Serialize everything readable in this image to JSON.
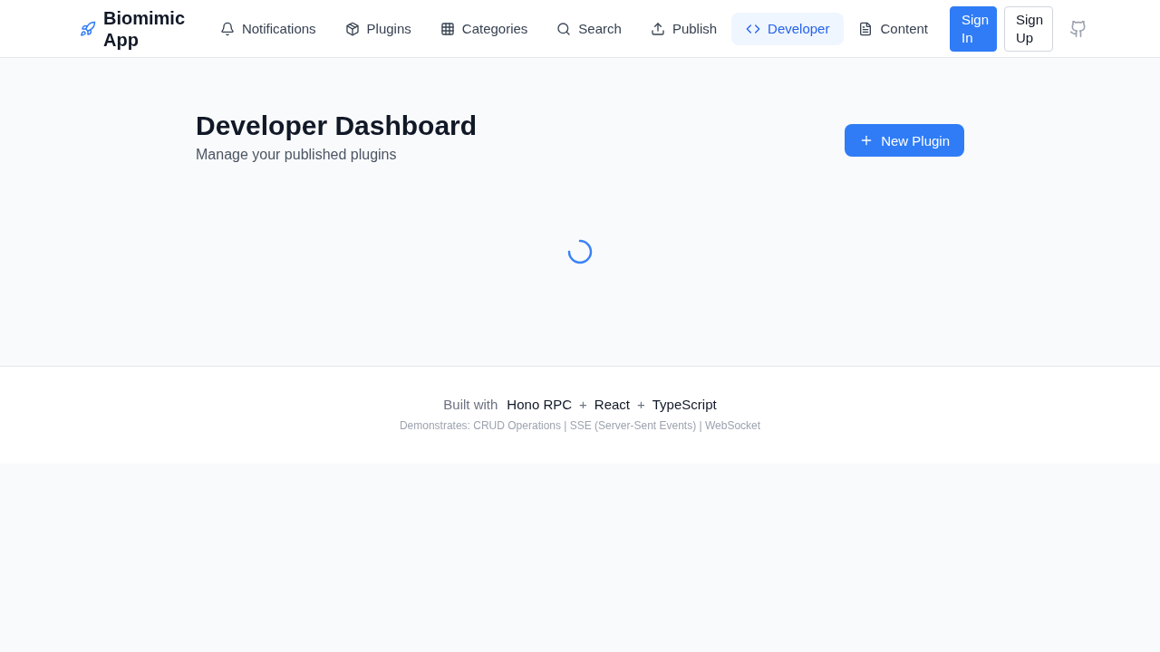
{
  "header": {
    "brand": "Biomimic App",
    "nav": [
      {
        "label": "Notifications",
        "selected": false
      },
      {
        "label": "Plugins",
        "selected": false
      },
      {
        "label": "Categories",
        "selected": false
      },
      {
        "label": "Search",
        "selected": false
      },
      {
        "label": "Publish",
        "selected": false
      },
      {
        "label": "Developer",
        "selected": true
      },
      {
        "label": "Content",
        "selected": false
      }
    ],
    "auth": [
      {
        "kind": "primary",
        "label": "Sign In"
      },
      {
        "kind": "outline",
        "label": "Sign Up"
      }
    ]
  },
  "main": {
    "title": "Developer Dashboard",
    "subtitle": "Manage your published plugins",
    "action": "New Plugin",
    "loading": true
  },
  "footer": {
    "parts": [
      {
        "kind": "label",
        "text": "Built with"
      },
      {
        "kind": "tech",
        "text": "Hono RPC"
      },
      {
        "kind": "sep",
        "text": "+"
      },
      {
        "kind": "tech",
        "text": "React"
      },
      {
        "kind": "sep",
        "text": "+"
      },
      {
        "kind": "tech",
        "text": "TypeScript"
      }
    ],
    "note": "Demonstrates: CRUD Operations | SSE (Server-Sent Events) | WebSocket"
  }
}
